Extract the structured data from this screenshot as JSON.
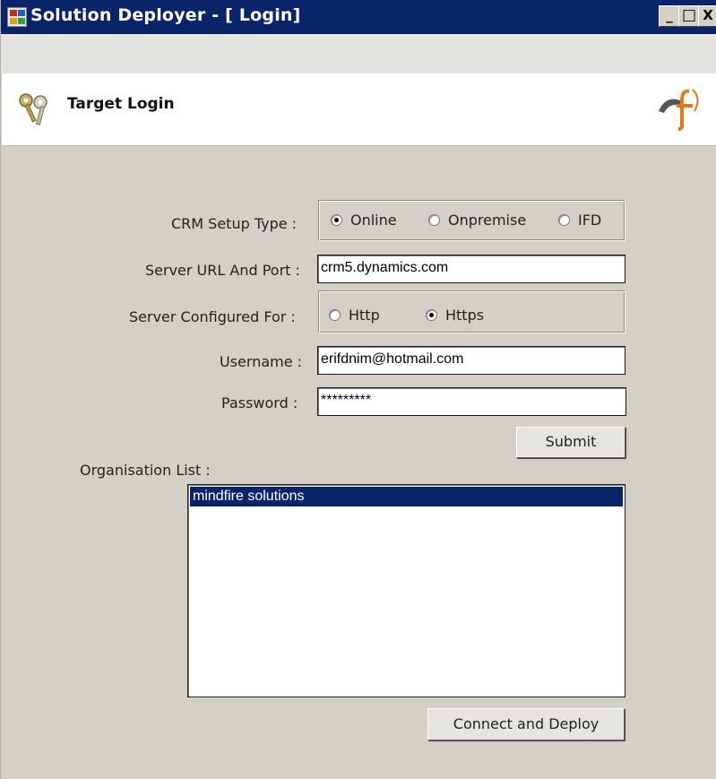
{
  "window": {
    "title": "Solution Deployer - [ Login]",
    "controls": [
      "_",
      "□",
      "X"
    ]
  },
  "header": {
    "title": "Target Login",
    "icon": "keys-icon",
    "logo": "mindfire-logo"
  },
  "form": {
    "crm_setup_type": {
      "label": "CRM Setup Type :",
      "options": [
        "Online",
        "Onpremise",
        "IFD"
      ],
      "selected": "Online"
    },
    "server_url": {
      "label": "Server URL And Port :",
      "value": "crm5.dynamics.com"
    },
    "server_configured": {
      "label": "Server Configured For :",
      "options": [
        "Http",
        "Https"
      ],
      "selected": "Https"
    },
    "username": {
      "label": "Username :",
      "value": "erifdnim@hotmail.com"
    },
    "password": {
      "label": "Password :",
      "value": "*********"
    },
    "submit_label": "Submit"
  },
  "organisation": {
    "label": "Organisation List :",
    "items": [
      "mindfire solutions"
    ],
    "selected_index": 0
  },
  "deploy_label": "Connect and  Deploy",
  "colors": {
    "titlebar": "#0a246a",
    "window_bg": "#d4d0c8",
    "selection": "#0a246a"
  }
}
